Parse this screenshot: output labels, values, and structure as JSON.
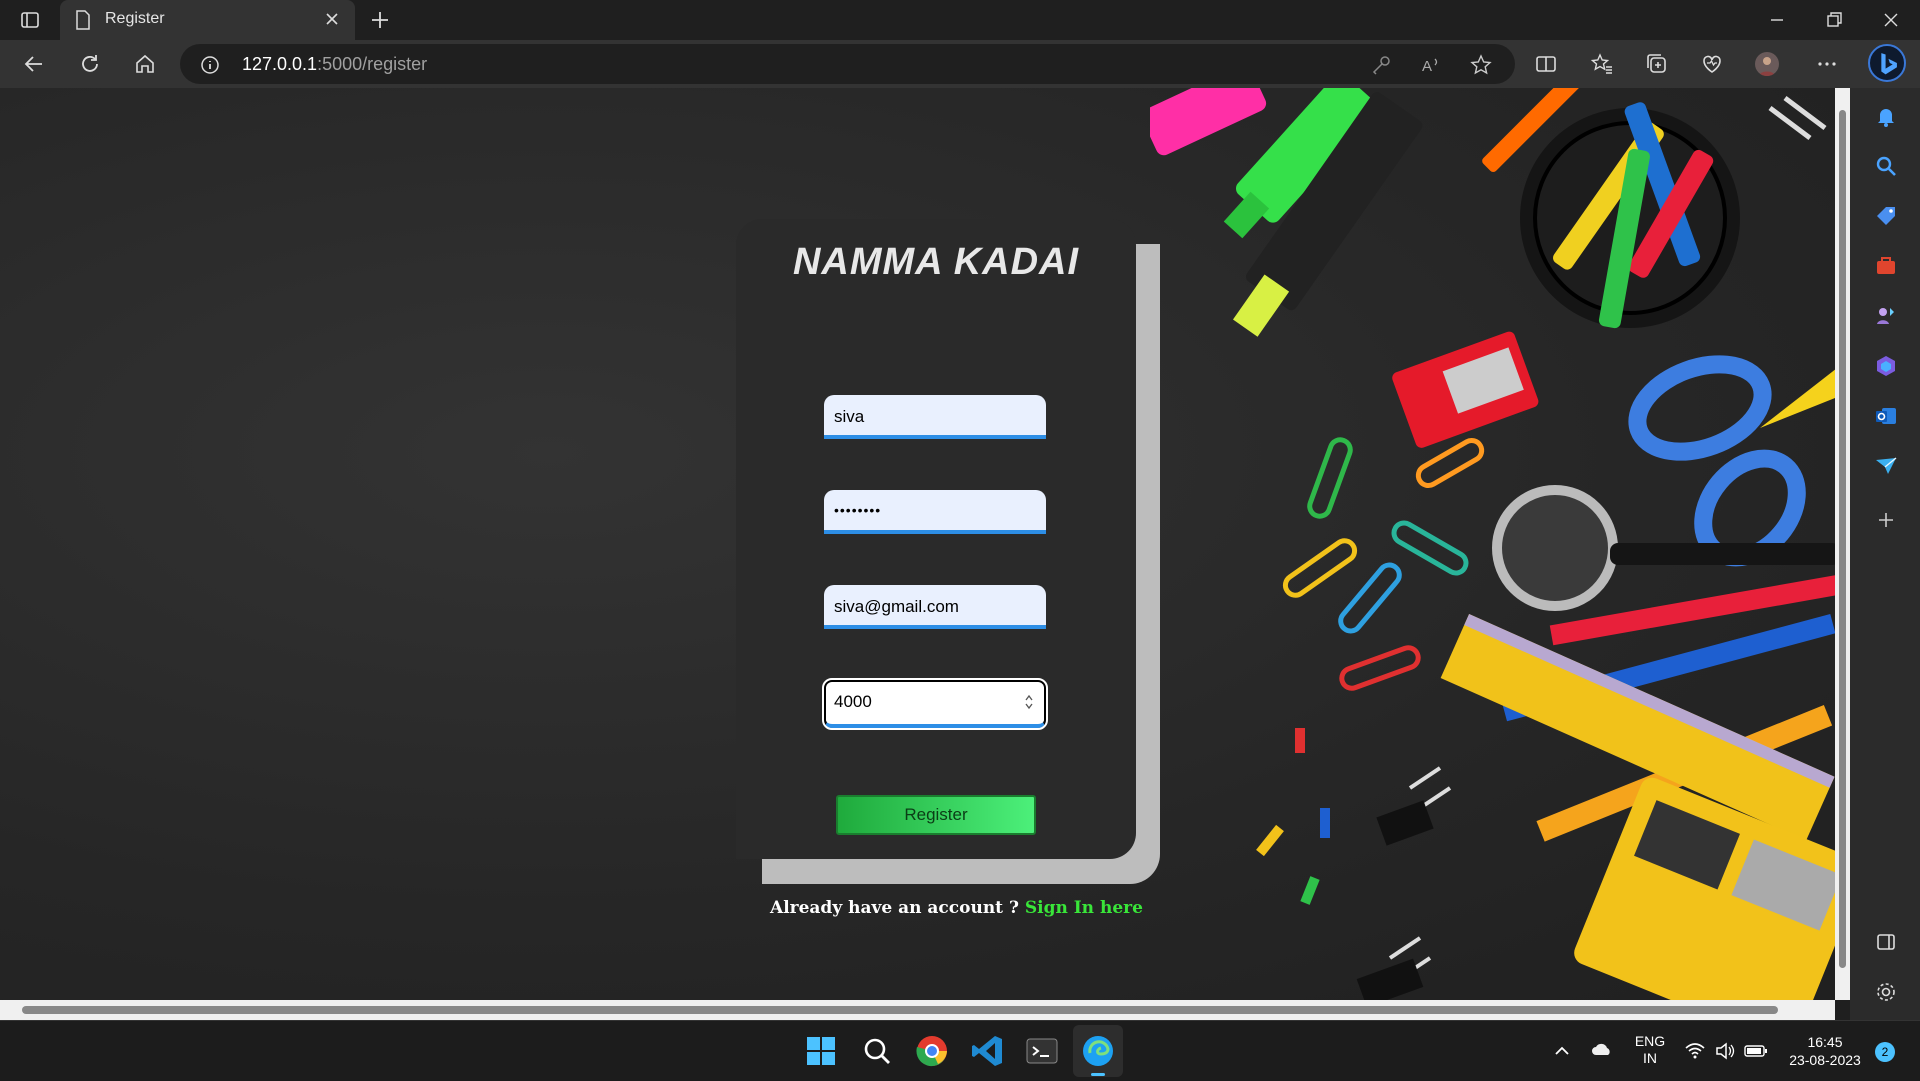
{
  "browser": {
    "tab_title": "Register",
    "url_host": "127.0.0.1",
    "url_path": ":5000/register"
  },
  "app": {
    "brand": "NAMMA KADAI",
    "username_value": "siva",
    "password_value": "••••••••",
    "email_value": "siva@gmail.com",
    "number_value": "4000",
    "register_label": "Register",
    "signin_prompt": "Already have an account ? ",
    "signin_link": "Sign In here"
  },
  "taskbar": {
    "lang_line1": "ENG",
    "lang_line2": "IN",
    "time": "16:45",
    "date": "23-08-2023",
    "notif_count": "2"
  },
  "colors": {
    "accent_blue": "#2d8ee6",
    "link_green": "#39e639",
    "button_green": "#2ecc5a"
  }
}
